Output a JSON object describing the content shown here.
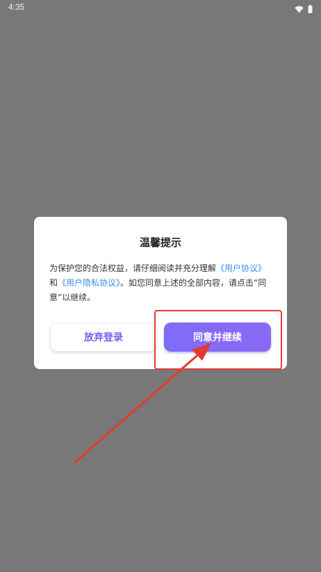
{
  "status_bar": {
    "time": "4:35",
    "icons": [
      "wifi-icon",
      "battery-icon"
    ]
  },
  "dialog": {
    "title": "温馨提示",
    "body": {
      "line1_prefix": "为保护您的合法权益，请仔细阅读并充分理解",
      "link_user_agreement": "《用户协议》",
      "line2_and": "和",
      "link_privacy": "《用户隐私协议》",
      "line2_suffix": "。如您同意上述的全部内容，请点击“同意”以继续。"
    },
    "cancel_label": "放弃登录",
    "confirm_label": "同意并继续"
  },
  "colors": {
    "overlay": "#787878",
    "accent": "#7e6cf7",
    "link": "#3b8fe8",
    "annotation": "#e23b2e"
  }
}
